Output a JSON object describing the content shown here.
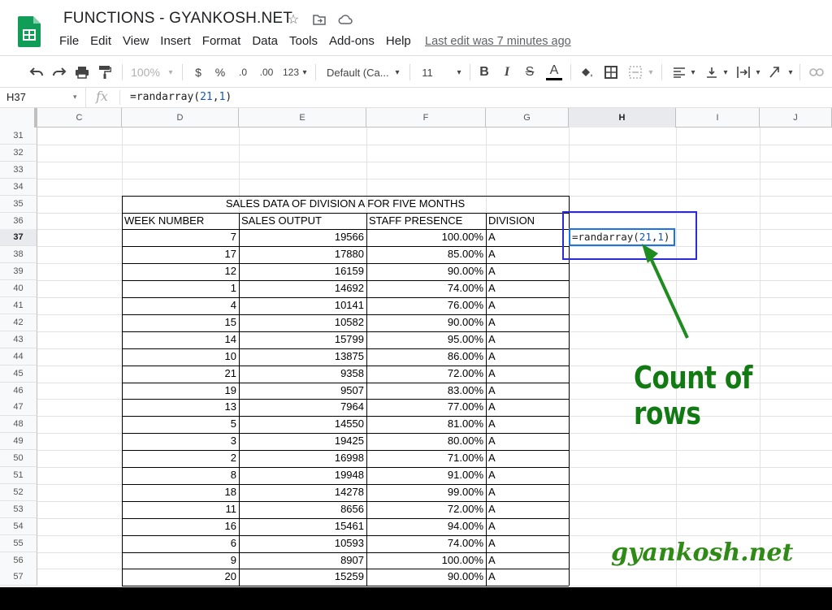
{
  "app": {
    "title": "FUNCTIONS - GYANKOSH.NET",
    "last_edit": "Last edit was 7 minutes ago",
    "menu": [
      "File",
      "Edit",
      "View",
      "Insert",
      "Format",
      "Data",
      "Tools",
      "Add-ons",
      "Help"
    ]
  },
  "toolbar": {
    "zoom": "100%",
    "currency": "$",
    "percent": "%",
    "decimal_decrease": ".0",
    "decimal_increase": ".00",
    "number_format": "123",
    "font": "Default (Ca...",
    "font_size": "11",
    "bold": "B",
    "italic": "I",
    "strike": "S",
    "text_color": "A"
  },
  "formula_bar": {
    "cell_ref": "H37",
    "fx": "fx",
    "formula_prefix": "=randarray(",
    "formula_arg1": "21",
    "formula_comma": ",",
    "formula_arg2": "1",
    "formula_suffix": ")"
  },
  "columns": [
    "C",
    "D",
    "E",
    "F",
    "G",
    "H",
    "I",
    "J"
  ],
  "rows": [
    "31",
    "32",
    "33",
    "34",
    "35",
    "36",
    "37",
    "38",
    "39",
    "40",
    "41",
    "42",
    "43",
    "44",
    "45",
    "46",
    "47",
    "48",
    "49",
    "50",
    "51",
    "52",
    "53",
    "54",
    "55",
    "56",
    "57"
  ],
  "table": {
    "title": "SALES DATA OF DIVISION A FOR FIVE MONTHS",
    "headers": [
      "WEEK NUMBER",
      "SALES OUTPUT",
      "STAFF PRESENCE",
      "DIVISION"
    ],
    "rows": [
      [
        "7",
        "19566",
        "100.00%",
        "A"
      ],
      [
        "17",
        "17880",
        "85.00%",
        "A"
      ],
      [
        "12",
        "16159",
        "90.00%",
        "A"
      ],
      [
        "1",
        "14692",
        "74.00%",
        "A"
      ],
      [
        "4",
        "10141",
        "76.00%",
        "A"
      ],
      [
        "15",
        "10582",
        "90.00%",
        "A"
      ],
      [
        "14",
        "15799",
        "95.00%",
        "A"
      ],
      [
        "10",
        "13875",
        "86.00%",
        "A"
      ],
      [
        "21",
        "9358",
        "72.00%",
        "A"
      ],
      [
        "19",
        "9507",
        "83.00%",
        "A"
      ],
      [
        "13",
        "7964",
        "77.00%",
        "A"
      ],
      [
        "5",
        "14550",
        "81.00%",
        "A"
      ],
      [
        "3",
        "19425",
        "80.00%",
        "A"
      ],
      [
        "2",
        "16998",
        "71.00%",
        "A"
      ],
      [
        "8",
        "19948",
        "91.00%",
        "A"
      ],
      [
        "18",
        "14278",
        "99.00%",
        "A"
      ],
      [
        "11",
        "8656",
        "72.00%",
        "A"
      ],
      [
        "16",
        "15461",
        "94.00%",
        "A"
      ],
      [
        "6",
        "10593",
        "74.00%",
        "A"
      ],
      [
        "9",
        "8907",
        "100.00%",
        "A"
      ],
      [
        "20",
        "15259",
        "90.00%",
        "A"
      ]
    ]
  },
  "active_cell": {
    "prefix": "=randarray(",
    "arg1": "21",
    "comma": ",",
    "arg2": "1",
    "suffix": ")"
  },
  "annotation": "Count of rows",
  "watermark": "gyankosh.net",
  "colors": {
    "accent_blue": "#1a73e8",
    "annotation_green": "#127a12",
    "box_blue": "#2a2ad8"
  }
}
